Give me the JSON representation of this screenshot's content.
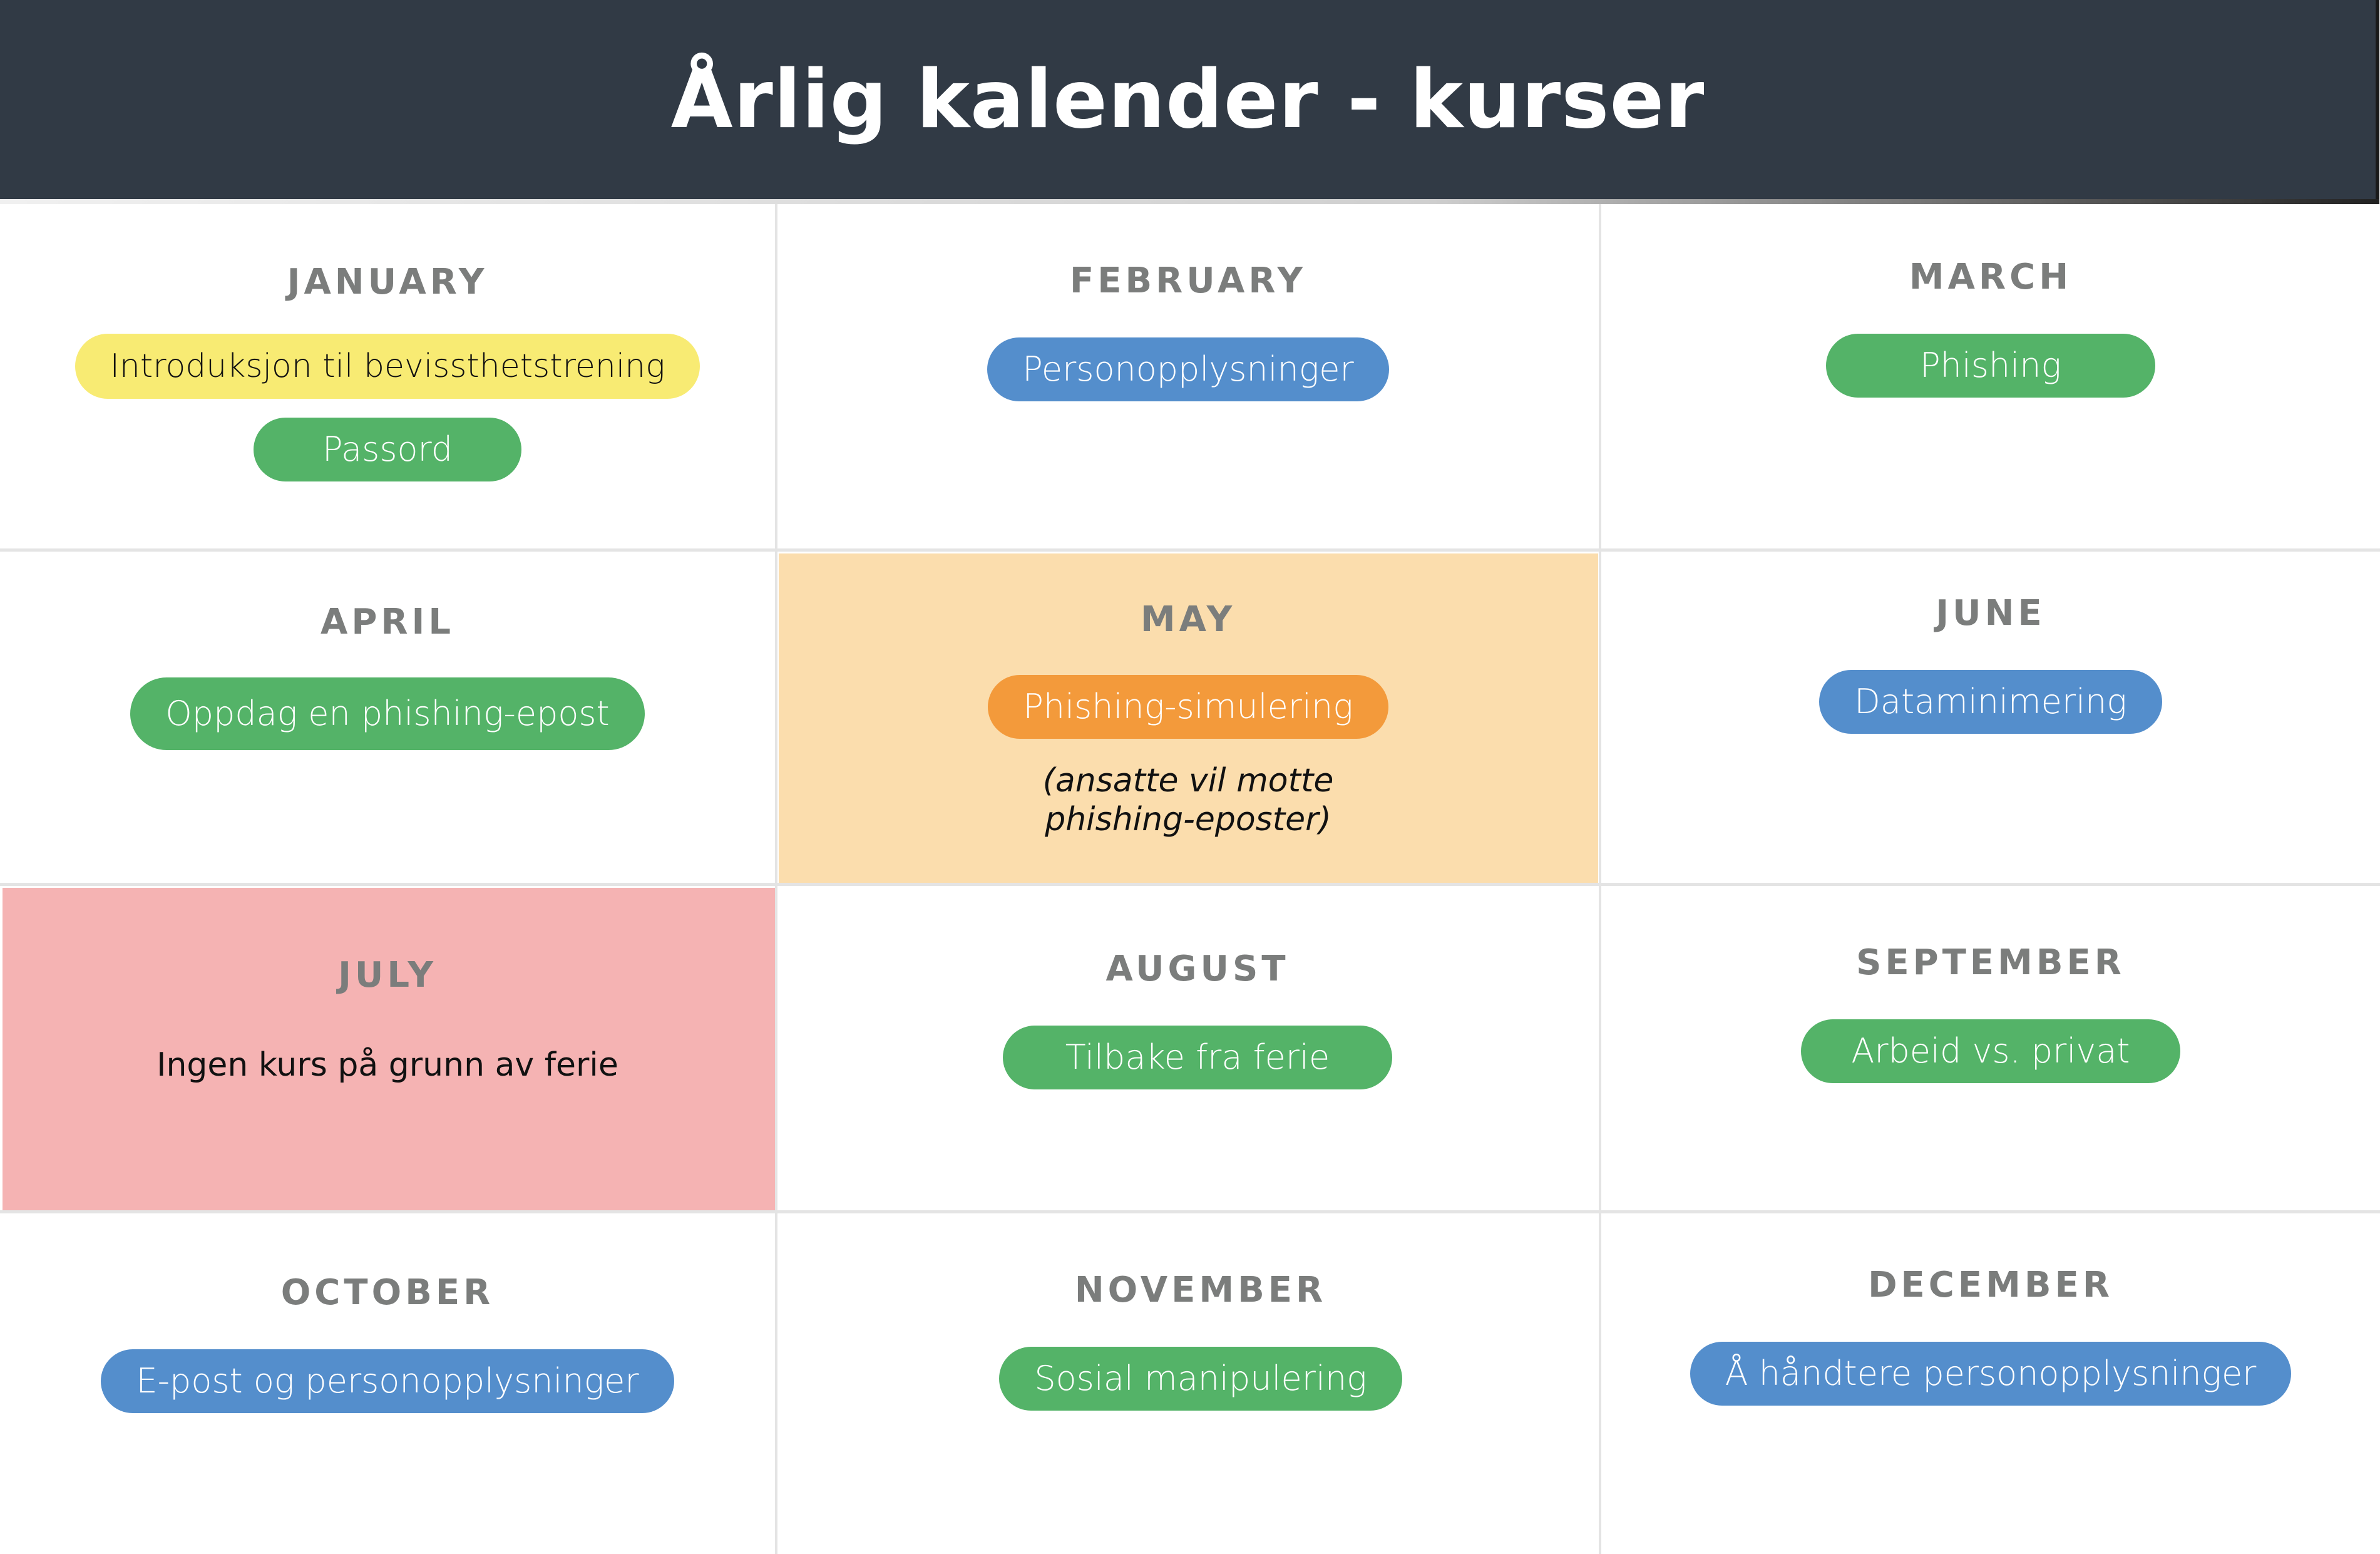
{
  "header": {
    "title": "Årlig kalender - kurser"
  },
  "colors": {
    "header_bg": "#313a45",
    "month_label": "#7b7d7c",
    "green": "#54b368",
    "blue": "#548ecc",
    "yellow": "#f8eb73",
    "orange": "#f39a3b",
    "may_highlight": "#fbddad",
    "july_highlight": "#f5b3b3"
  },
  "months": [
    {
      "name": "JANUARY",
      "courses": [
        {
          "label": "Introduksjon til bevissthetstrening",
          "color": "yellow"
        },
        {
          "label": "Passord",
          "color": "green"
        }
      ]
    },
    {
      "name": "FEBRUARY",
      "courses": [
        {
          "label": "Personopplysninger",
          "color": "blue"
        }
      ]
    },
    {
      "name": "MARCH",
      "courses": [
        {
          "label": "Phishing",
          "color": "green"
        }
      ]
    },
    {
      "name": "APRIL",
      "courses": [
        {
          "label": "Oppdag en phishing-epost",
          "color": "green"
        }
      ]
    },
    {
      "name": "MAY",
      "courses": [
        {
          "label": "Phishing-simulering",
          "color": "orange"
        }
      ],
      "note": "(ansatte vil motte phishing-eposter)"
    },
    {
      "name": "JUNE",
      "courses": [
        {
          "label": "Dataminimering",
          "color": "blue"
        }
      ]
    },
    {
      "name": "JULY",
      "courses": [],
      "note": "Ingen kurs på grunn av ferie"
    },
    {
      "name": "AUGUST",
      "courses": [
        {
          "label": "Tilbake fra ferie",
          "color": "green"
        }
      ]
    },
    {
      "name": "SEPTEMBER",
      "courses": [
        {
          "label": "Arbeid vs. privat",
          "color": "green"
        }
      ]
    },
    {
      "name": "OCTOBER",
      "courses": [
        {
          "label": "E-post og personopplysninger",
          "color": "blue"
        }
      ]
    },
    {
      "name": "NOVEMBER",
      "courses": [
        {
          "label": "Sosial manipulering",
          "color": "green"
        }
      ]
    },
    {
      "name": "DECEMBER",
      "courses": [
        {
          "label": "Å håndtere personopplysninger",
          "color": "blue"
        }
      ]
    }
  ]
}
